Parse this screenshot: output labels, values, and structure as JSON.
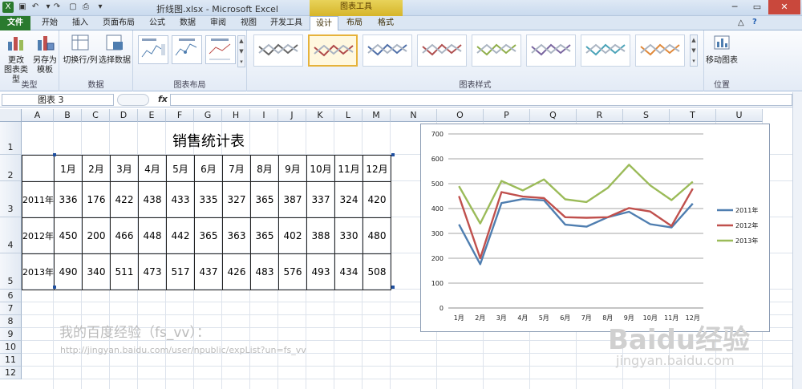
{
  "window": {
    "title": "折线图.xlsx - Microsoft Excel",
    "context_label": "图表工具"
  },
  "tabs": [
    "文件",
    "开始",
    "插入",
    "页面布局",
    "公式",
    "数据",
    "审阅",
    "视图",
    "开发工具",
    "设计",
    "布局",
    "格式"
  ],
  "ribbon": {
    "type_group": {
      "label": "类型",
      "change_type": [
        "更改",
        "图表类型"
      ],
      "save_template": [
        "另存为",
        "模板"
      ]
    },
    "data_group": {
      "label": "数据",
      "switch": "切换行/列",
      "select": "选择数据"
    },
    "layout_group": {
      "label": "图表布局"
    },
    "style_group": {
      "label": "图表样式",
      "colors": [
        "#666666",
        "#b04a4a",
        "#4f6fa8",
        "#b05050",
        "#8fae4a",
        "#7a66a0",
        "#4aa3b8",
        "#e0893a"
      ]
    },
    "location_group": {
      "label": "位置",
      "move": "移动图表"
    }
  },
  "formula_bar": {
    "name_box": "图表 3",
    "fx": "fx"
  },
  "columns": [
    "A",
    "B",
    "C",
    "D",
    "E",
    "F",
    "G",
    "H",
    "I",
    "J",
    "K",
    "L",
    "M",
    "N",
    "O",
    "P",
    "Q",
    "R",
    "S",
    "T",
    "U"
  ],
  "rows": [
    "1",
    "2",
    "3",
    "4",
    "5",
    "6",
    "7",
    "8",
    "9",
    "10",
    "11",
    "12"
  ],
  "sheet": {
    "title": "销售统计表",
    "months": [
      "1月",
      "2月",
      "3月",
      "4月",
      "5月",
      "6月",
      "7月",
      "8月",
      "9月",
      "10月",
      "11月",
      "12月"
    ],
    "data_rows": [
      {
        "label": "2011年",
        "values": [
          "336",
          "176",
          "422",
          "438",
          "433",
          "335",
          "327",
          "365",
          "387",
          "337",
          "324",
          "420"
        ]
      },
      {
        "label": "2012年",
        "values": [
          "450",
          "200",
          "466",
          "448",
          "442",
          "365",
          "363",
          "365",
          "402",
          "388",
          "330",
          "480"
        ]
      },
      {
        "label": "2013年",
        "values": [
          "490",
          "340",
          "511",
          "473",
          "517",
          "437",
          "426",
          "483",
          "576",
          "493",
          "434",
          "508"
        ]
      }
    ]
  },
  "notes": {
    "line1": "我的百度经验（fs_vv）：",
    "line2": "http://jingyan.baidu.com/user/npublic/expList?un=fs_vv"
  },
  "watermark": {
    "brand": "Baidu经验",
    "url": "jingyan.baidu.com"
  },
  "chart_data": {
    "type": "line",
    "categories": [
      "1月",
      "2月",
      "3月",
      "4月",
      "5月",
      "6月",
      "7月",
      "8月",
      "9月",
      "10月",
      "11月",
      "12月"
    ],
    "series": [
      {
        "name": "2011年",
        "color": "#4f7eb0",
        "values": [
          336,
          176,
          422,
          438,
          433,
          335,
          327,
          365,
          387,
          337,
          324,
          420
        ]
      },
      {
        "name": "2012年",
        "color": "#c0504d",
        "values": [
          450,
          200,
          466,
          448,
          442,
          365,
          363,
          365,
          402,
          388,
          330,
          480
        ]
      },
      {
        "name": "2013年",
        "color": "#9bbb59",
        "values": [
          490,
          340,
          511,
          473,
          517,
          437,
          426,
          483,
          576,
          493,
          434,
          508
        ]
      }
    ],
    "ylim": [
      0,
      700
    ],
    "yticks": [
      "0",
      "100",
      "200",
      "300",
      "400",
      "500",
      "600",
      "700"
    ],
    "grid": true,
    "legend": "right"
  }
}
